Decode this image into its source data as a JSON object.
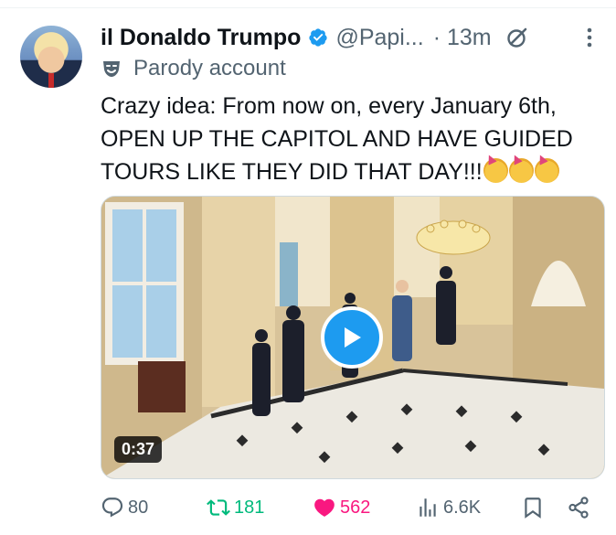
{
  "post": {
    "author": {
      "name": "il Donaldo Trumpo",
      "handle": "@Papi...",
      "time": "· 13m",
      "verified": true,
      "label": "Parody account"
    },
    "text": "Crazy idea: From now on, every January 6th, OPEN UP THE CAPITOL AND HAVE GUIDED TOURS LIKE THEY DID THAT DAY!!!",
    "emojis": [
      "partying-face",
      "partying-face",
      "partying-face"
    ],
    "media": {
      "type": "video",
      "duration": "0:37"
    },
    "stats": {
      "replies": "80",
      "reposts": "181",
      "likes": "562",
      "views": "6.6K"
    },
    "liked": true
  },
  "colors": {
    "accent": "#1d9bf0",
    "repost": "#00ba7c",
    "like": "#f91880",
    "muted": "#536471"
  },
  "icons": [
    "verified-badge-icon",
    "grok-icon",
    "more-icon",
    "parody-mask-icon",
    "play-icon",
    "reply-icon",
    "repost-icon",
    "heart-icon",
    "views-icon",
    "bookmark-icon",
    "share-icon"
  ]
}
